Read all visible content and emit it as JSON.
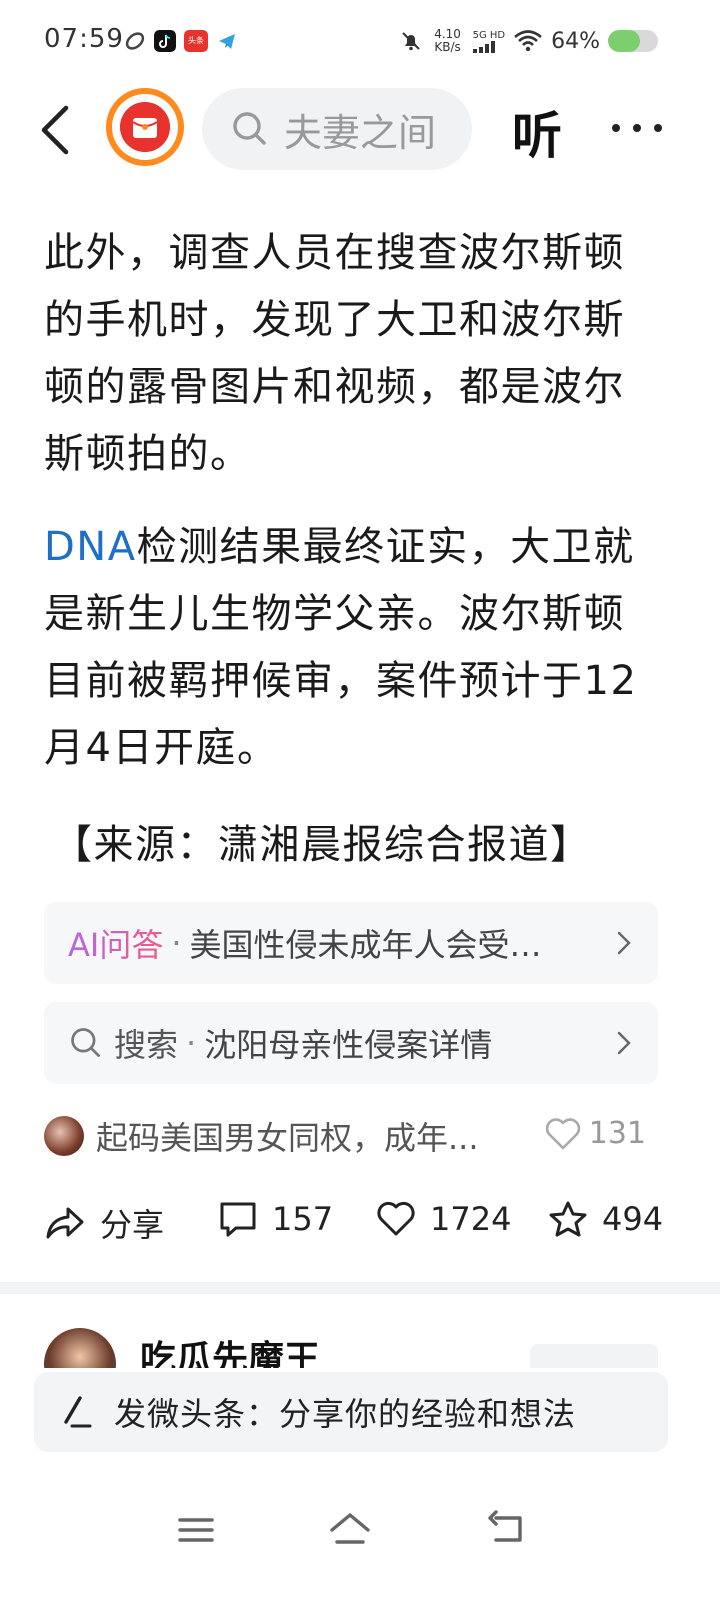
{
  "status_bar": {
    "time": "07:59",
    "net_speed_value": "4.10",
    "net_speed_unit": "KB/s",
    "signal_label": "5G HD",
    "battery_percent_text": "64%",
    "battery_level": 0.64,
    "mini_app_badge": "头条"
  },
  "nav": {
    "search_text": "夫妻之间",
    "listen_label": "听"
  },
  "article": {
    "paragraph1": "此外，调查人员在搜查波尔斯顿的手机时，发现了大卫和波尔斯顿的露骨图片和视频，都是波尔斯顿拍的。",
    "paragraph2_link": "DNA",
    "paragraph2_rest": "检测结果最终证实，大卫就是新生儿生物学父亲。波尔斯顿目前被羁押候审，案件预计于12月4日开庭。",
    "source": "【来源：潇湘晨报综合报道】"
  },
  "ai_card": {
    "label": "AI问答",
    "text": "美国性侵未成年人会受…"
  },
  "search_card": {
    "label": "搜索",
    "text": "沈阳母亲性侵案详情"
  },
  "comment": {
    "text": "起码美国男女同权，成年...",
    "likes": "131"
  },
  "actions": {
    "share_label": "分享",
    "comments": "157",
    "likes": "1724",
    "favorites": "494"
  },
  "next_post": {
    "author": "吃瓜先魔王"
  },
  "compose": {
    "placeholder": "发微头条：分享你的经验和想法"
  },
  "colors": {
    "link": "#1d6fc7",
    "accent_orange": "#ff8a1e",
    "accent_red": "#e8322e",
    "battery_green": "#7ccf6c"
  }
}
